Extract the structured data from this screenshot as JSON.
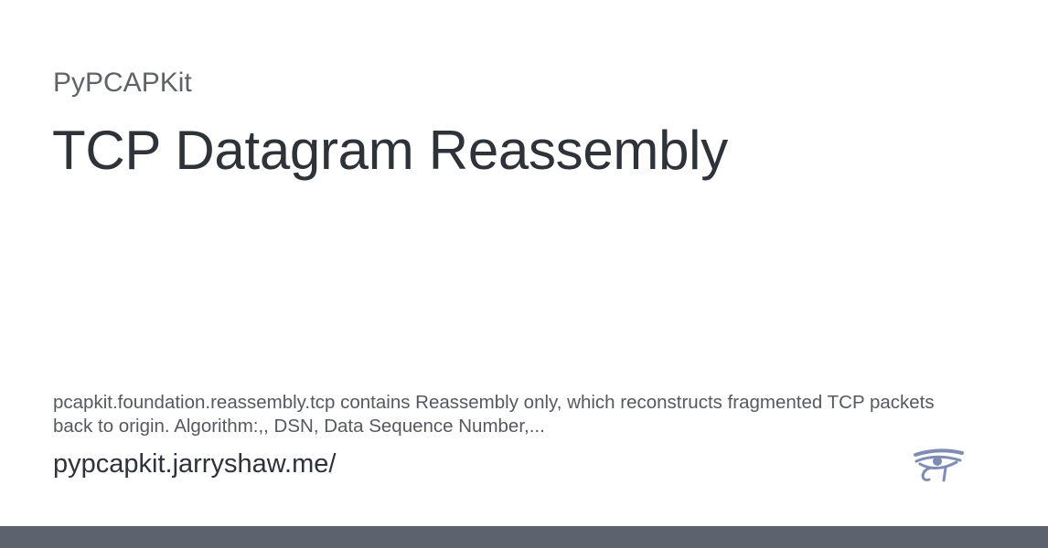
{
  "site_name": "PyPCAPKit",
  "title": "TCP Datagram Reassembly",
  "description": "pcapkit.foundation.reassembly.tcp contains Reassembly only, which reconstructs fragmented TCP packets back to origin. Algorithm:,, DSN, Data Sequence Number,...",
  "url": "pypcapkit.jarryshaw.me/",
  "logo": {
    "icon": "eye-of-horus-icon",
    "color": "#7f8db5"
  },
  "colors": {
    "footer_bar": "#5c636e",
    "title": "#2e3239"
  }
}
